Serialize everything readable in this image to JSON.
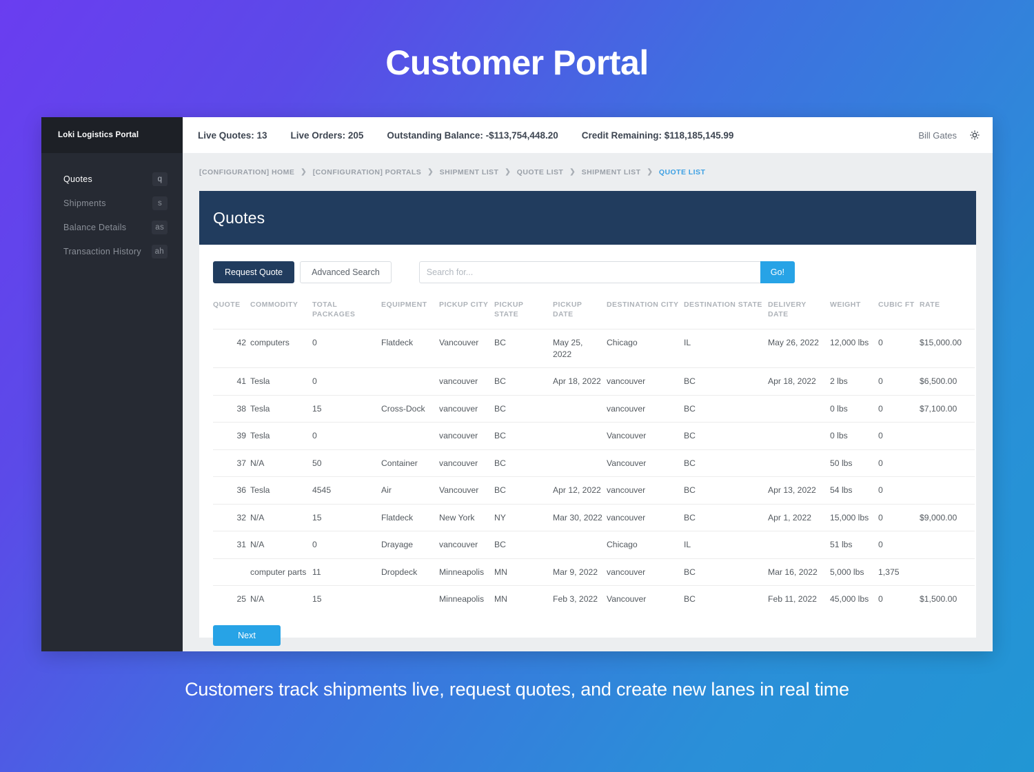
{
  "hero": {
    "title": "Customer Portal",
    "caption": "Customers track shipments live, request quotes, and create new lanes in real time"
  },
  "sidebar": {
    "brand": "Loki Logistics Portal",
    "items": [
      {
        "label": "Quotes",
        "key": "q",
        "active": true
      },
      {
        "label": "Shipments",
        "key": "s",
        "active": false
      },
      {
        "label": "Balance Details",
        "key": "as",
        "active": false
      },
      {
        "label": "Transaction History",
        "key": "ah",
        "active": false
      }
    ]
  },
  "topbar": {
    "stats": [
      "Live Quotes: 13",
      "Live Orders: 205",
      "Outstanding Balance: -$113,754,448.20",
      "Credit Remaining: $118,185,145.99"
    ],
    "user": "Bill Gates",
    "settings_icon": "gear-icon"
  },
  "breadcrumb": {
    "separator": "❯",
    "items": [
      {
        "label": "[CONFIGURATION] HOME",
        "current": false
      },
      {
        "label": "[CONFIGURATION] PORTALS",
        "current": false
      },
      {
        "label": "SHIPMENT LIST",
        "current": false
      },
      {
        "label": "QUOTE LIST",
        "current": false
      },
      {
        "label": "SHIPMENT LIST",
        "current": false
      },
      {
        "label": "QUOTE LIST",
        "current": true
      }
    ]
  },
  "section": {
    "heading": "Quotes"
  },
  "toolbar": {
    "request_quote_label": "Request Quote",
    "advanced_search_label": "Advanced Search",
    "search_placeholder": "Search for...",
    "search_value": "",
    "go_label": "Go!"
  },
  "table": {
    "columns": [
      "QUOTE",
      "COMMODITY",
      "TOTAL PACKAGES",
      "EQUIPMENT",
      "PICKUP CITY",
      "PICKUP STATE",
      "PICKUP DATE",
      "DESTINATION CITY",
      "DESTINATION STATE",
      "DELIVERY DATE",
      "WEIGHT",
      "CUBIC FT",
      "RATE"
    ],
    "rows": [
      {
        "quote": "42",
        "commodity": "computers",
        "packages": "0",
        "equipment": "Flatdeck",
        "pickup_city": "Vancouver",
        "pickup_state": "BC",
        "pickup_date": "May 25, 2022",
        "dest_city": "Chicago",
        "dest_state": "IL",
        "delivery_date": "May 26, 2022",
        "weight": "12,000 lbs",
        "cubic_ft": "0",
        "rate": "$15,000.00"
      },
      {
        "quote": "41",
        "commodity": "Tesla",
        "packages": "0",
        "equipment": "",
        "pickup_city": "vancouver",
        "pickup_state": "BC",
        "pickup_date": "Apr 18, 2022",
        "dest_city": "vancouver",
        "dest_state": "BC",
        "delivery_date": "Apr 18, 2022",
        "weight": "2 lbs",
        "cubic_ft": "0",
        "rate": "$6,500.00"
      },
      {
        "quote": "38",
        "commodity": "Tesla",
        "packages": "15",
        "equipment": "Cross-Dock",
        "pickup_city": "vancouver",
        "pickup_state": "BC",
        "pickup_date": "",
        "dest_city": "vancouver",
        "dest_state": "BC",
        "delivery_date": "",
        "weight": "0 lbs",
        "cubic_ft": "0",
        "rate": "$7,100.00"
      },
      {
        "quote": "39",
        "commodity": "Tesla",
        "packages": "0",
        "equipment": "",
        "pickup_city": "vancouver",
        "pickup_state": "BC",
        "pickup_date": "",
        "dest_city": "Vancouver",
        "dest_state": "BC",
        "delivery_date": "",
        "weight": "0 lbs",
        "cubic_ft": "0",
        "rate": ""
      },
      {
        "quote": "37",
        "commodity": "N/A",
        "packages": "50",
        "equipment": "Container",
        "pickup_city": "vancouver",
        "pickup_state": "BC",
        "pickup_date": "",
        "dest_city": "Vancouver",
        "dest_state": "BC",
        "delivery_date": "",
        "weight": "50 lbs",
        "cubic_ft": "0",
        "rate": ""
      },
      {
        "quote": "36",
        "commodity": "Tesla",
        "packages": "4545",
        "equipment": "Air",
        "pickup_city": "Vancouver",
        "pickup_state": "BC",
        "pickup_date": "Apr 12, 2022",
        "dest_city": "vancouver",
        "dest_state": "BC",
        "delivery_date": "Apr 13, 2022",
        "weight": "54 lbs",
        "cubic_ft": "0",
        "rate": ""
      },
      {
        "quote": "32",
        "commodity": "N/A",
        "packages": "15",
        "equipment": "Flatdeck",
        "pickup_city": "New York",
        "pickup_state": "NY",
        "pickup_date": "Mar 30, 2022",
        "dest_city": "vancouver",
        "dest_state": "BC",
        "delivery_date": "Apr 1, 2022",
        "weight": "15,000 lbs",
        "cubic_ft": "0",
        "rate": "$9,000.00"
      },
      {
        "quote": "31",
        "commodity": "N/A",
        "packages": "0",
        "equipment": "Drayage",
        "pickup_city": "vancouver",
        "pickup_state": "BC",
        "pickup_date": "",
        "dest_city": "Chicago",
        "dest_state": "IL",
        "delivery_date": "",
        "weight": "51 lbs",
        "cubic_ft": "0",
        "rate": ""
      },
      {
        "quote": "",
        "commodity": "computer parts",
        "packages": "11",
        "equipment": "Dropdeck",
        "pickup_city": "Minneapolis",
        "pickup_state": "MN",
        "pickup_date": "Mar 9, 2022",
        "dest_city": "vancouver",
        "dest_state": "BC",
        "delivery_date": "Mar 16, 2022",
        "weight": "5,000 lbs",
        "cubic_ft": "1,375",
        "rate": ""
      },
      {
        "quote": "25",
        "commodity": "N/A",
        "packages": "15",
        "equipment": "",
        "pickup_city": "Minneapolis",
        "pickup_state": "MN",
        "pickup_date": "Feb 3, 2022",
        "dest_city": "Vancouver",
        "dest_state": "BC",
        "delivery_date": "Feb 11, 2022",
        "weight": "45,000 lbs",
        "cubic_ft": "0",
        "rate": "$1,500.00"
      }
    ]
  },
  "pagination": {
    "next_label": "Next"
  },
  "colors": {
    "accent_blue": "#27a3e6",
    "banner_navy": "#213c5e",
    "sidebar_dark": "#262a33",
    "breadcrumb_current": "#3da0e3"
  }
}
